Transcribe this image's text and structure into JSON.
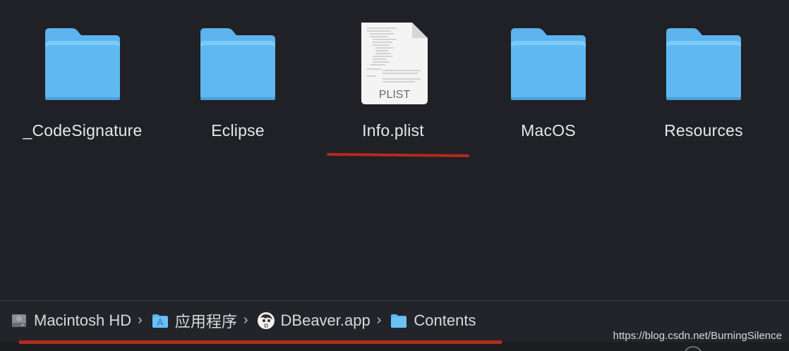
{
  "files": [
    {
      "name": "_CodeSignature",
      "icon": "folder-icon"
    },
    {
      "name": "Eclipse",
      "icon": "folder-icon"
    },
    {
      "name": "Info.plist",
      "icon": "plist-file-icon",
      "badge": "PLIST"
    },
    {
      "name": "MacOS",
      "icon": "folder-icon"
    },
    {
      "name": "Resources",
      "icon": "folder-icon"
    }
  ],
  "path_bar": {
    "items": [
      {
        "label": "Macintosh HD",
        "icon": "hard-drive-icon"
      },
      {
        "label": "应用程序",
        "icon": "applications-folder-icon"
      },
      {
        "label": "DBeaver.app",
        "icon": "dbeaver-app-icon"
      },
      {
        "label": "Contents",
        "icon": "folder-icon"
      }
    ],
    "separator": "›"
  },
  "watermark": "https://blog.csdn.net/BurningSilence",
  "colors": {
    "background": "#202126",
    "folder_top": "#6cc1f4",
    "folder_body": "#58b0ee",
    "annotation_red": "#b22a1f",
    "label_text": "#e7e7ea"
  }
}
